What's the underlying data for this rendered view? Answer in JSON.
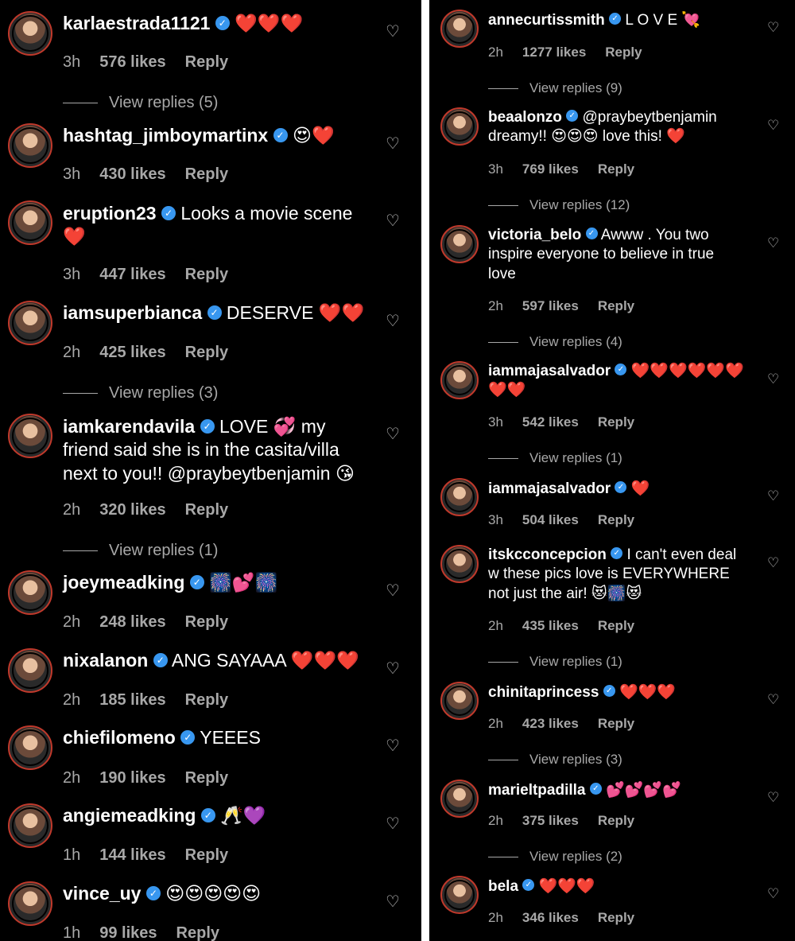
{
  "left": [
    {
      "user": "karlaestrada1121",
      "text": "❤️❤️❤️",
      "time": "3h",
      "likes": "576 likes",
      "reply": "Reply",
      "view_replies": "View replies (5)"
    },
    {
      "user": "hashtag_jimboymartinx",
      "text": "😍❤️",
      "time": "3h",
      "likes": "430 likes",
      "reply": "Reply"
    },
    {
      "user": "eruption23",
      "text": "Looks a movie scene ❤️",
      "time": "3h",
      "likes": "447 likes",
      "reply": "Reply"
    },
    {
      "user": "iamsuperbianca",
      "text": "DESERVE ❤️❤️",
      "time": "2h",
      "likes": "425 likes",
      "reply": "Reply",
      "view_replies": "View replies (3)"
    },
    {
      "user": "iamkarendavila",
      "text": "LOVE 💞 my friend said she is in the casita/villa next to you!! @praybeytbenjamin 😘",
      "time": "2h",
      "likes": "320 likes",
      "reply": "Reply",
      "view_replies": "View replies (1)"
    },
    {
      "user": "joeymeadking",
      "text": "🎆💕🎆",
      "time": "2h",
      "likes": "248 likes",
      "reply": "Reply"
    },
    {
      "user": "nixalanon",
      "text": "ANG SAYAAA ❤️❤️❤️",
      "time": "2h",
      "likes": "185 likes",
      "reply": "Reply"
    },
    {
      "user": "chiefilomeno",
      "text": "YEEES",
      "time": "2h",
      "likes": "190 likes",
      "reply": "Reply"
    },
    {
      "user": "angiemeadking",
      "text": "🥂💜",
      "time": "1h",
      "likes": "144 likes",
      "reply": "Reply"
    },
    {
      "user": "vince_uy",
      "text": "😍😍😍😍😍",
      "time": "1h",
      "likes": "99 likes",
      "reply": "Reply"
    }
  ],
  "right": [
    {
      "user": "annecurtissmith",
      "text": "L O V E 💘",
      "time": "2h",
      "likes": "1277 likes",
      "reply": "Reply",
      "view_replies": "View replies (9)"
    },
    {
      "user": "beaalonzo",
      "text": "@praybeytbenjamin dreamy!! 😍😍😍 love this! ❤️",
      "time": "3h",
      "likes": "769 likes",
      "reply": "Reply",
      "view_replies": "View replies (12)"
    },
    {
      "user": "victoria_belo",
      "text": "Awww . You two inspire everyone to believe in true love",
      "time": "2h",
      "likes": "597 likes",
      "reply": "Reply",
      "view_replies": "View replies (4)"
    },
    {
      "user": "iammajasalvador",
      "text": "❤️❤️❤️❤️❤️❤️ ❤️❤️",
      "time": "3h",
      "likes": "542 likes",
      "reply": "Reply",
      "view_replies": "View replies (1)"
    },
    {
      "user": "iammajasalvador",
      "text": "❤️",
      "time": "3h",
      "likes": "504 likes",
      "reply": "Reply"
    },
    {
      "user": "itskcconcepcion",
      "text": "I can't even deal w these pics love is EVERYWHERE not just the air! 😻🎆😻",
      "time": "2h",
      "likes": "435 likes",
      "reply": "Reply",
      "view_replies": "View replies (1)"
    },
    {
      "user": "chinitaprincess",
      "text": "❤️❤️❤️",
      "time": "2h",
      "likes": "423 likes",
      "reply": "Reply",
      "view_replies": "View replies (3)"
    },
    {
      "user": "marieltpadilla",
      "text": "💕💕💕💕",
      "time": "2h",
      "likes": "375 likes",
      "reply": "Reply",
      "view_replies": "View replies (2)"
    },
    {
      "user": "bela",
      "text": "❤️❤️❤️",
      "time": "2h",
      "likes": "346 likes",
      "reply": "Reply"
    }
  ],
  "icons": {
    "like": "heart-outline-icon",
    "verified": "verified-badge-icon"
  },
  "colors": {
    "background": "#000000",
    "text": "#ffffff",
    "muted": "#a8a8a8",
    "verified": "#3897f0",
    "heart": "#e0245e"
  }
}
